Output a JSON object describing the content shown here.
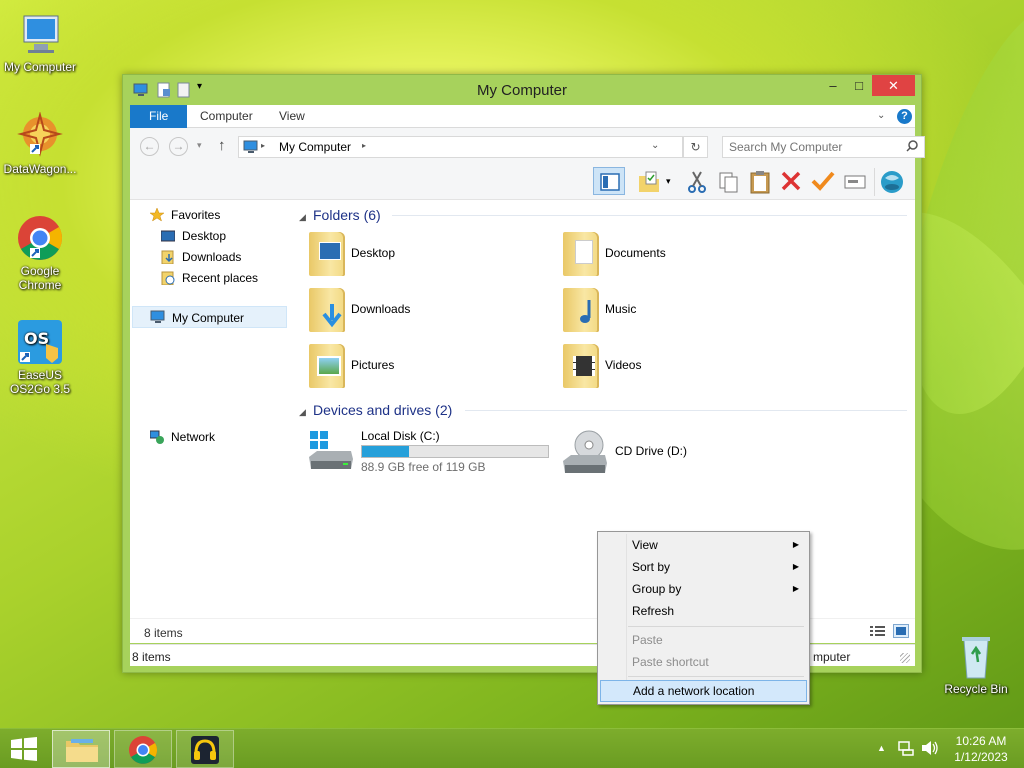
{
  "desktop": {
    "icons": [
      {
        "label": "My Computer"
      },
      {
        "label": "DataWagon..."
      },
      {
        "label": "Google Chrome"
      },
      {
        "label": "EaseUS OS2Go 3.5"
      },
      {
        "label": "Recycle Bin"
      }
    ]
  },
  "window": {
    "title": "My Computer",
    "controls": {
      "minimize": "‒",
      "maximize": "□",
      "close": "✕"
    },
    "ribbon": {
      "tabs": [
        "File",
        "Computer",
        "View"
      ],
      "help": "?"
    },
    "address": {
      "path": "My Computer",
      "search_placeholder": "Search My Computer"
    },
    "nav": {
      "favorites": "Favorites",
      "items": [
        "Desktop",
        "Downloads",
        "Recent places"
      ],
      "computer": "My Computer",
      "network": "Network"
    },
    "folders_header": "Folders (6)",
    "folders": [
      "Desktop",
      "Documents",
      "Downloads",
      "Music",
      "Pictures",
      "Videos"
    ],
    "drives_header": "Devices and drives (2)",
    "drives": [
      {
        "name": "Local Disk (C:)",
        "free": "88.9 GB free of 119 GB",
        "used_fraction": 0.253
      },
      {
        "name": "CD Drive (D:)"
      }
    ],
    "status_items": "8 items",
    "status_items2": "8 items",
    "status_right": "mputer"
  },
  "context_menu": {
    "items": [
      {
        "label": "View",
        "submenu": true,
        "enabled": true
      },
      {
        "label": "Sort by",
        "submenu": true,
        "enabled": true
      },
      {
        "label": "Group by",
        "submenu": true,
        "enabled": true
      },
      {
        "label": "Refresh",
        "enabled": true
      },
      {
        "label": "Paste",
        "enabled": false
      },
      {
        "label": "Paste shortcut",
        "enabled": false
      },
      {
        "label": "Add a network location",
        "enabled": true,
        "highlighted": true
      }
    ]
  },
  "taskbar": {
    "time": "10:26 AM",
    "date": "1/12/2023"
  },
  "colors": {
    "accent": "#1979ca",
    "window_frame": "#a7d25c",
    "close": "#e04343",
    "highlight": "#cde8ff",
    "drive_bar": "#26a0da"
  }
}
